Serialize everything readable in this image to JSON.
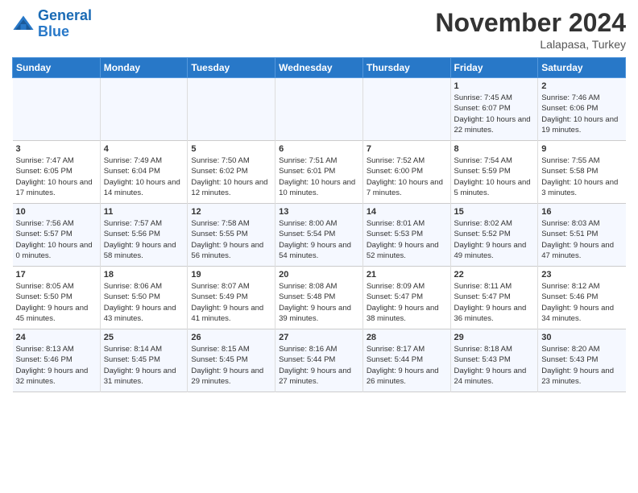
{
  "header": {
    "logo_line1": "General",
    "logo_line2": "Blue",
    "month": "November 2024",
    "location": "Lalapasa, Turkey"
  },
  "days_of_week": [
    "Sunday",
    "Monday",
    "Tuesday",
    "Wednesday",
    "Thursday",
    "Friday",
    "Saturday"
  ],
  "weeks": [
    [
      {
        "day": "",
        "info": ""
      },
      {
        "day": "",
        "info": ""
      },
      {
        "day": "",
        "info": ""
      },
      {
        "day": "",
        "info": ""
      },
      {
        "day": "",
        "info": ""
      },
      {
        "day": "1",
        "info": "Sunrise: 7:45 AM\nSunset: 6:07 PM\nDaylight: 10 hours and 22 minutes."
      },
      {
        "day": "2",
        "info": "Sunrise: 7:46 AM\nSunset: 6:06 PM\nDaylight: 10 hours and 19 minutes."
      }
    ],
    [
      {
        "day": "3",
        "info": "Sunrise: 7:47 AM\nSunset: 6:05 PM\nDaylight: 10 hours and 17 minutes."
      },
      {
        "day": "4",
        "info": "Sunrise: 7:49 AM\nSunset: 6:04 PM\nDaylight: 10 hours and 14 minutes."
      },
      {
        "day": "5",
        "info": "Sunrise: 7:50 AM\nSunset: 6:02 PM\nDaylight: 10 hours and 12 minutes."
      },
      {
        "day": "6",
        "info": "Sunrise: 7:51 AM\nSunset: 6:01 PM\nDaylight: 10 hours and 10 minutes."
      },
      {
        "day": "7",
        "info": "Sunrise: 7:52 AM\nSunset: 6:00 PM\nDaylight: 10 hours and 7 minutes."
      },
      {
        "day": "8",
        "info": "Sunrise: 7:54 AM\nSunset: 5:59 PM\nDaylight: 10 hours and 5 minutes."
      },
      {
        "day": "9",
        "info": "Sunrise: 7:55 AM\nSunset: 5:58 PM\nDaylight: 10 hours and 3 minutes."
      }
    ],
    [
      {
        "day": "10",
        "info": "Sunrise: 7:56 AM\nSunset: 5:57 PM\nDaylight: 10 hours and 0 minutes."
      },
      {
        "day": "11",
        "info": "Sunrise: 7:57 AM\nSunset: 5:56 PM\nDaylight: 9 hours and 58 minutes."
      },
      {
        "day": "12",
        "info": "Sunrise: 7:58 AM\nSunset: 5:55 PM\nDaylight: 9 hours and 56 minutes."
      },
      {
        "day": "13",
        "info": "Sunrise: 8:00 AM\nSunset: 5:54 PM\nDaylight: 9 hours and 54 minutes."
      },
      {
        "day": "14",
        "info": "Sunrise: 8:01 AM\nSunset: 5:53 PM\nDaylight: 9 hours and 52 minutes."
      },
      {
        "day": "15",
        "info": "Sunrise: 8:02 AM\nSunset: 5:52 PM\nDaylight: 9 hours and 49 minutes."
      },
      {
        "day": "16",
        "info": "Sunrise: 8:03 AM\nSunset: 5:51 PM\nDaylight: 9 hours and 47 minutes."
      }
    ],
    [
      {
        "day": "17",
        "info": "Sunrise: 8:05 AM\nSunset: 5:50 PM\nDaylight: 9 hours and 45 minutes."
      },
      {
        "day": "18",
        "info": "Sunrise: 8:06 AM\nSunset: 5:50 PM\nDaylight: 9 hours and 43 minutes."
      },
      {
        "day": "19",
        "info": "Sunrise: 8:07 AM\nSunset: 5:49 PM\nDaylight: 9 hours and 41 minutes."
      },
      {
        "day": "20",
        "info": "Sunrise: 8:08 AM\nSunset: 5:48 PM\nDaylight: 9 hours and 39 minutes."
      },
      {
        "day": "21",
        "info": "Sunrise: 8:09 AM\nSunset: 5:47 PM\nDaylight: 9 hours and 38 minutes."
      },
      {
        "day": "22",
        "info": "Sunrise: 8:11 AM\nSunset: 5:47 PM\nDaylight: 9 hours and 36 minutes."
      },
      {
        "day": "23",
        "info": "Sunrise: 8:12 AM\nSunset: 5:46 PM\nDaylight: 9 hours and 34 minutes."
      }
    ],
    [
      {
        "day": "24",
        "info": "Sunrise: 8:13 AM\nSunset: 5:46 PM\nDaylight: 9 hours and 32 minutes."
      },
      {
        "day": "25",
        "info": "Sunrise: 8:14 AM\nSunset: 5:45 PM\nDaylight: 9 hours and 31 minutes."
      },
      {
        "day": "26",
        "info": "Sunrise: 8:15 AM\nSunset: 5:45 PM\nDaylight: 9 hours and 29 minutes."
      },
      {
        "day": "27",
        "info": "Sunrise: 8:16 AM\nSunset: 5:44 PM\nDaylight: 9 hours and 27 minutes."
      },
      {
        "day": "28",
        "info": "Sunrise: 8:17 AM\nSunset: 5:44 PM\nDaylight: 9 hours and 26 minutes."
      },
      {
        "day": "29",
        "info": "Sunrise: 8:18 AM\nSunset: 5:43 PM\nDaylight: 9 hours and 24 minutes."
      },
      {
        "day": "30",
        "info": "Sunrise: 8:20 AM\nSunset: 5:43 PM\nDaylight: 9 hours and 23 minutes."
      }
    ]
  ]
}
